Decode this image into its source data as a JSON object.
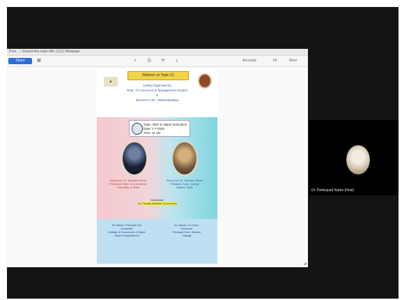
{
  "window": {
    "title": "Pres... / shared-doc-topic-title (1)(1) Webpage"
  },
  "toolbar": {
    "share_label": "Share",
    "zoom_label": "Fit",
    "right_items": [
      "Annotate",
      "Fit",
      "More"
    ]
  },
  "poster": {
    "banner": "Webinar on Topic (1)",
    "header_lines": [
      "Jointly Organised by",
      "Dept. of Commerce & Management Studies",
      "&",
      "Women's Cell - Mahavidyalaya"
    ],
    "topic_lines": [
      "Topic: NEP & Higher Education",
      "Date: 1-7-2020",
      "Time: 11 am"
    ],
    "speaker_left_lines": [
      "Resource: Dr. Speaker Name",
      "Professor, Dept. of Commerce",
      "University of State"
    ],
    "speaker_right_lines": [
      "Resource: Dr. Speaker Name",
      "Principal, Govt. College",
      "District, State"
    ],
    "moderator_lines": [
      "Moderator:",
      "Dr. Faculty Member (Convener)"
    ],
    "organizer_left_lines": [
      "Dr. Name, Principal (I/c)",
      "Convener",
      "College of Commerce & Mgmt.",
      "Head of Department"
    ],
    "organizer_right_lines": [
      "Dr. Name, Co-Conv.",
      "Convener",
      "Principal Govt. Women",
      "College"
    ]
  },
  "participant": {
    "name": "Dr. Participant Name (Host)"
  }
}
